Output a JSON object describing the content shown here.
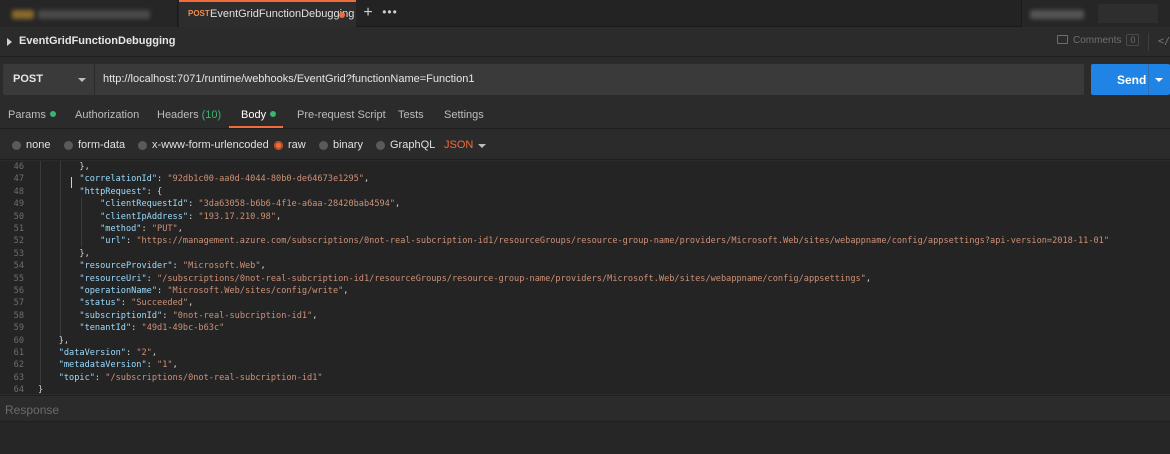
{
  "tabs": {
    "active": {
      "method": "POST",
      "title": "EventGridFunctionDebugging"
    },
    "new_tab_label": "+",
    "more_label": "•••"
  },
  "request": {
    "name": "EventGridFunctionDebugging",
    "comments_label": "Comments",
    "comments_count": "0",
    "method": "POST",
    "url": "http://localhost:7071/runtime/webhooks/EventGrid?functionName=Function1",
    "send_label": "Send"
  },
  "request_tabs": [
    {
      "label": "Params",
      "dot": true
    },
    {
      "label": "Authorization"
    },
    {
      "label": "Headers",
      "count": "(10)"
    },
    {
      "label": "Body",
      "dot": true,
      "active": true
    },
    {
      "label": "Pre-request Script"
    },
    {
      "label": "Tests"
    },
    {
      "label": "Settings"
    }
  ],
  "body_types": {
    "options": [
      "none",
      "form-data",
      "x-www-form-urlencoded",
      "raw",
      "binary",
      "GraphQL"
    ],
    "selected": "raw",
    "format": "JSON"
  },
  "editor": {
    "lines": [
      {
        "n": "46",
        "text": "        },"
      },
      {
        "n": "47",
        "key": "\"correlationId\"",
        "value": "\"92db1c00-aa0d-4044-80b0-de64673e1295\"",
        "indent": "        ",
        "trail": ","
      },
      {
        "n": "48",
        "key": "\"httpRequest\"",
        "indent": "        ",
        "trail": ": {"
      },
      {
        "n": "49",
        "key": "\"clientRequestId\"",
        "value": "\"3da63058-b6b6-4f1e-a6aa-28420bab4594\"",
        "indent": "            ",
        "trail": ","
      },
      {
        "n": "50",
        "key": "\"clientIpAddress\"",
        "value": "\"193.17.210.98\"",
        "indent": "            ",
        "trail": ","
      },
      {
        "n": "51",
        "key": "\"method\"",
        "value": "\"PUT\"",
        "indent": "            ",
        "trail": ","
      },
      {
        "n": "52",
        "key": "\"url\"",
        "value": "\"https://management.azure.com/subscriptions/0not-real-subcription-id1/resourceGroups/resource-group-name/providers/Microsoft.Web/sites/webappname/config/appsettings?api-version=2018-11-01\"",
        "indent": "            ",
        "trail": ""
      },
      {
        "n": "53",
        "text": "        },"
      },
      {
        "n": "54",
        "key": "\"resourceProvider\"",
        "value": "\"Microsoft.Web\"",
        "indent": "        ",
        "trail": ","
      },
      {
        "n": "55",
        "key": "\"resourceUri\"",
        "value": "\"/subscriptions/0not-real-subcription-id1/resourceGroups/resource-group-name/providers/Microsoft.Web/sites/webappname/config/appsettings\"",
        "indent": "        ",
        "trail": ","
      },
      {
        "n": "56",
        "key": "\"operationName\"",
        "value": "\"Microsoft.Web/sites/config/write\"",
        "indent": "        ",
        "trail": ","
      },
      {
        "n": "57",
        "key": "\"status\"",
        "value": "\"Succeeded\"",
        "indent": "        ",
        "trail": ","
      },
      {
        "n": "58",
        "key": "\"subscriptionId\"",
        "value": "\"0not-real-subcription-id1\"",
        "indent": "        ",
        "trail": ","
      },
      {
        "n": "59",
        "key": "\"tenantId\"",
        "value": "\"49d1-49bc-b63c\"",
        "indent": "        ",
        "trail": ""
      },
      {
        "n": "60",
        "text": "    },"
      },
      {
        "n": "61",
        "key": "\"dataVersion\"",
        "value": "\"2\"",
        "indent": "    ",
        "trail": ","
      },
      {
        "n": "62",
        "key": "\"metadataVersion\"",
        "value": "\"1\"",
        "indent": "    ",
        "trail": ","
      },
      {
        "n": "63",
        "key": "\"topic\"",
        "value": "\"/subscriptions/0not-real-subcription-id1\"",
        "indent": "    ",
        "trail": ""
      },
      {
        "n": "64",
        "text": "}"
      }
    ]
  },
  "response": {
    "label": "Response"
  },
  "colors": {
    "accent": "#f26b3a",
    "send": "#1f84e5",
    "ok_dot": "#3cb371",
    "json_key": "#9cdcfe",
    "json_string": "#ce9178"
  },
  "icons": [
    "caret-right-icon",
    "comment-icon",
    "code-icon",
    "caret-down-icon",
    "radio-icon"
  ]
}
